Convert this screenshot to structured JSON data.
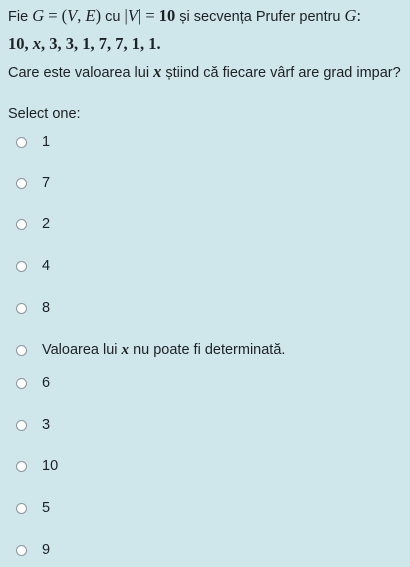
{
  "question": {
    "line1_prefix": "Fie",
    "line1_math_G": "G = (V, E)",
    "line1_cu": "cu",
    "line1_math_V": "|V| = 10",
    "line1_suffix": "și secvența Prufer pentru",
    "line1_math_G2": "G:",
    "sequence": "10, x, 3, 3, 1, 7, 7, 1, 1.",
    "line3_prefix": "Care este valoarea lui",
    "line3_var": "x",
    "line3_suffix": "știind că fiecare vârf are grad impar?"
  },
  "prompt": "Select one:",
  "options": [
    {
      "label": "1"
    },
    {
      "label": "7"
    },
    {
      "label": "2"
    },
    {
      "label": "4"
    },
    {
      "label": "8"
    },
    {
      "label_prefix": "Valoarea lui",
      "label_var": "x",
      "label_suffix": "nu poate fi determinată."
    },
    {
      "label": "6"
    },
    {
      "label": "3"
    },
    {
      "label": "10"
    },
    {
      "label": "5"
    },
    {
      "label": "9"
    }
  ]
}
